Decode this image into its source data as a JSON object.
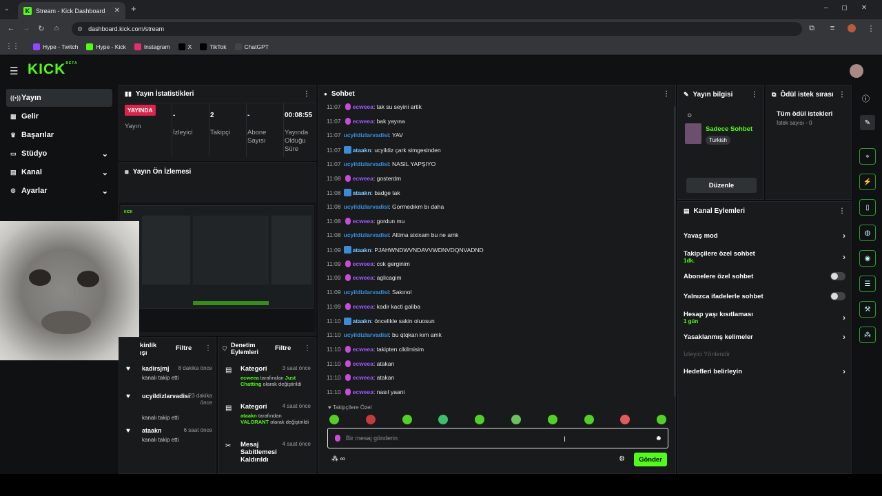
{
  "browser": {
    "tab_title": "Stream - Kick Dashboard",
    "url": "dashboard.kick.com/stream",
    "bookmarks": [
      {
        "label": "Hype - Twitch",
        "color": "#9146ff"
      },
      {
        "label": "Hype - Kick",
        "color": "#53fc18"
      },
      {
        "label": "Instagram",
        "color": "#e1306c"
      },
      {
        "label": "X",
        "color": "#000000"
      },
      {
        "label": "TikTok",
        "color": "#000000"
      },
      {
        "label": "ChatGPT",
        "color": "#444444"
      }
    ]
  },
  "app": {
    "logo": "KICK",
    "logo_sup": "BETA",
    "accent": "#53fc18"
  },
  "sidebar": {
    "items": [
      {
        "label": "Yayın",
        "icon": "broadcast-icon",
        "active": true,
        "expand": false
      },
      {
        "label": "Gelir",
        "icon": "money-icon",
        "active": false,
        "expand": false
      },
      {
        "label": "Başarılar",
        "icon": "trophy-icon",
        "active": false,
        "expand": false
      },
      {
        "label": "Stüdyo",
        "icon": "studio-icon",
        "active": false,
        "expand": true
      },
      {
        "label": "Kanal",
        "icon": "channel-icon",
        "active": false,
        "expand": true
      },
      {
        "label": "Ayarlar",
        "icon": "gear-icon",
        "active": false,
        "expand": true
      }
    ]
  },
  "stats": {
    "title": "Yayın İstatistikleri",
    "live_badge": "YAYINDA",
    "live_label": "Yayın",
    "cols": [
      {
        "value": "-",
        "label": "İzleyici"
      },
      {
        "value": "2",
        "label": "Takipçi"
      },
      {
        "value": "-",
        "label": "Abone Sayısı"
      },
      {
        "value": "00:08:55",
        "label": "Yayında Olduğu Süre"
      }
    ]
  },
  "preview": {
    "title": "Yayın Ön İzlemesi"
  },
  "activity": {
    "title": "Etkinlik Akışı",
    "title_visible": "kinlik\nışı",
    "filter": "Filtre",
    "items": [
      {
        "user": "kadirsjmj",
        "time": "8 dakika önce",
        "desc": "kanalı takip etti"
      },
      {
        "user": "ucyildizlarvadisi",
        "time": "23 dakika önce",
        "desc": "kanalı takip etti"
      },
      {
        "user": "ataakn",
        "time": "6 saat önce",
        "desc": "kanalı takip etti"
      }
    ]
  },
  "audit": {
    "title": "Denetim Eylemleri",
    "filter": "Filtre",
    "items": [
      {
        "title": "Kategori",
        "time": "3 saat önce",
        "user": "ecweea",
        "mid": " tarafından ",
        "highlight": "Just Chatting",
        "tail": " olarak değiştirildi"
      },
      {
        "title": "Kategori",
        "time": "4 saat önce",
        "user": "ataakn",
        "mid": " tarafından ",
        "highlight": "VALORANT",
        "tail": " olarak değiştirildi"
      },
      {
        "title": "Mesaj Sabitlemesi Kaldırıldı",
        "time": "4 saat önce",
        "user": "",
        "mid": "",
        "highlight": "",
        "tail": ""
      }
    ]
  },
  "chat": {
    "title": "Sohbet",
    "messages": [
      {
        "time": "11:07",
        "user": "ecweea",
        "kind": "ec",
        "text": "tak su seyini artik"
      },
      {
        "time": "11:07",
        "user": "ecweea",
        "kind": "ec",
        "text": "bak yayına"
      },
      {
        "time": "11:07",
        "user": "ucyildizlarvadisi",
        "kind": "uc",
        "text": "YAV"
      },
      {
        "time": "11:07",
        "user": "ataakn",
        "kind": "at",
        "text": "ucyildiz çark simgesinden"
      },
      {
        "time": "11:07",
        "user": "ucyildizlarvadisi",
        "kind": "uc",
        "text": "NASIL YAPŞIYO"
      },
      {
        "time": "11:08",
        "user": "ecweea",
        "kind": "ec",
        "text": "gosterdm"
      },
      {
        "time": "11:08",
        "user": "ataakn",
        "kind": "at",
        "text": "badge tak"
      },
      {
        "time": "11:08",
        "user": "ucyildizlarvadisi",
        "kind": "uc",
        "text": "Gormedıkm bı daha"
      },
      {
        "time": "11:08",
        "user": "ecweea",
        "kind": "ec",
        "text": "gordun mu"
      },
      {
        "time": "11:08",
        "user": "ucyildizlarvadisi",
        "kind": "uc",
        "text": "Altima sixixam bu ne amk"
      },
      {
        "time": "11:09",
        "user": "ataakn",
        "kind": "at",
        "text": "PJAHWNDWVNDAVVWDNVDQNVADND"
      },
      {
        "time": "11:09",
        "user": "ecweea",
        "kind": "ec",
        "text": "cok gerginim"
      },
      {
        "time": "11:09",
        "user": "ecweea",
        "kind": "ec",
        "text": "aglicagim"
      },
      {
        "time": "11:09",
        "user": "ucyildizlarvadisi",
        "kind": "uc",
        "text": "Sakınol"
      },
      {
        "time": "11:09",
        "user": "ecweea",
        "kind": "ec",
        "text": "kadir kacti galiba"
      },
      {
        "time": "11:10",
        "user": "ataakn",
        "kind": "at",
        "text": "öncelikle sakin oluosun"
      },
      {
        "time": "11:10",
        "user": "ucyildizlarvadisi",
        "kind": "uc",
        "text": "bu qtqkan kım amk"
      },
      {
        "time": "11:10",
        "user": "ecweea",
        "kind": "ec",
        "text": "takipten cikilmisim"
      },
      {
        "time": "11:10",
        "user": "ecweea",
        "kind": "ec",
        "text": "atakan"
      },
      {
        "time": "11:10",
        "user": "ecweea",
        "kind": "ec",
        "text": "atakan"
      },
      {
        "time": "11:10",
        "user": "ecweea",
        "kind": "ec",
        "text": "nasıl yaani"
      }
    ],
    "followers_only": "Takipçilere Özel",
    "input_placeholder": "Bir mesaj gönderin",
    "send": "Gönder"
  },
  "streaminfo": {
    "title": "Yayın bilgisi",
    "stream_title": "Sadece Sohbet",
    "tag": "Turkish",
    "edit": "Düzenle"
  },
  "rewards": {
    "title": "Ödül istek sırası",
    "all": "Tüm ödül istekleri",
    "count": "İstek sayısı - 0"
  },
  "channel_actions": {
    "title": "Kanal Eylemleri",
    "items": [
      {
        "label": "Yavaş mod",
        "sub": "",
        "ctrl": "chevron",
        "disabled": false
      },
      {
        "label": "Takipçilere özel sohbet",
        "sub": "1dk.",
        "ctrl": "chevron",
        "disabled": false
      },
      {
        "label": "Abonelere özel sohbet",
        "sub": "",
        "ctrl": "toggle",
        "disabled": false
      },
      {
        "label": "Yalnızca ifadelerle sohbet",
        "sub": "",
        "ctrl": "toggle",
        "disabled": false
      },
      {
        "label": "Hesap yaşı kısıtlaması",
        "sub": "1 gün",
        "ctrl": "chevron",
        "disabled": false
      },
      {
        "label": "Yasaklanmış kelimeler",
        "sub": "",
        "ctrl": "chevron",
        "disabled": false
      },
      {
        "label": "İzleyici Yönlendir",
        "sub": "",
        "ctrl": "none",
        "disabled": true
      },
      {
        "label": "Hedefleri belirleyin",
        "sub": "",
        "ctrl": "chevron",
        "disabled": false
      }
    ]
  }
}
